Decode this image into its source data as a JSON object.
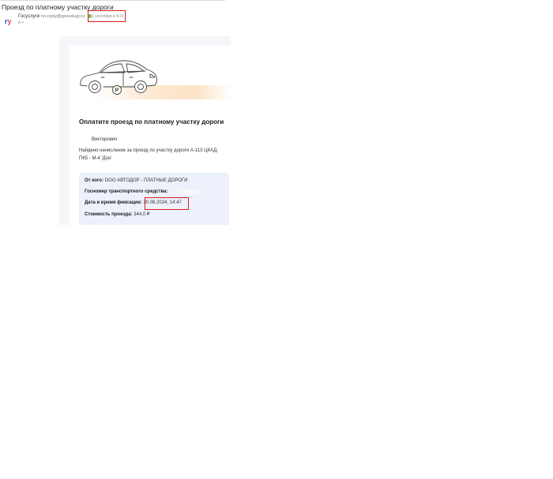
{
  "email": {
    "subject": "Проезд по платному участку дороги",
    "sender_name": "Госуслуги",
    "sender_email": "no-reply@gosuslugi.ru",
    "to_line": "я >",
    "date": "1 сентября в 4:21",
    "logo": {
      "g": "г",
      "u": "у"
    }
  },
  "content": {
    "title": "Оплатите проезд по платному участку дороги",
    "greeting": "Викторович",
    "body_line1": "Найдено начисление за проезд по участку дороги А-113 ЦКАД,",
    "body_line2": "ПК5 - М-4 'Дон'",
    "details": {
      "from_label": "От кого:",
      "from_value": "ООО АВТОДОР - ПЛАТНЫЕ ДОРОГИ",
      "plate_label": "Госномер транспортного средства:",
      "datetime_label": "Дата и время фиксации:",
      "datetime_value": "30.08.2024, 14:47",
      "cost_label": "Стоимость проезда:",
      "cost_value": "344,0 ₽"
    }
  },
  "colors": {
    "highlight": "#d32020",
    "info_bg": "#edf1fc",
    "brand_blue": "#0d4cd3",
    "brand_red": "#ee3f58"
  }
}
